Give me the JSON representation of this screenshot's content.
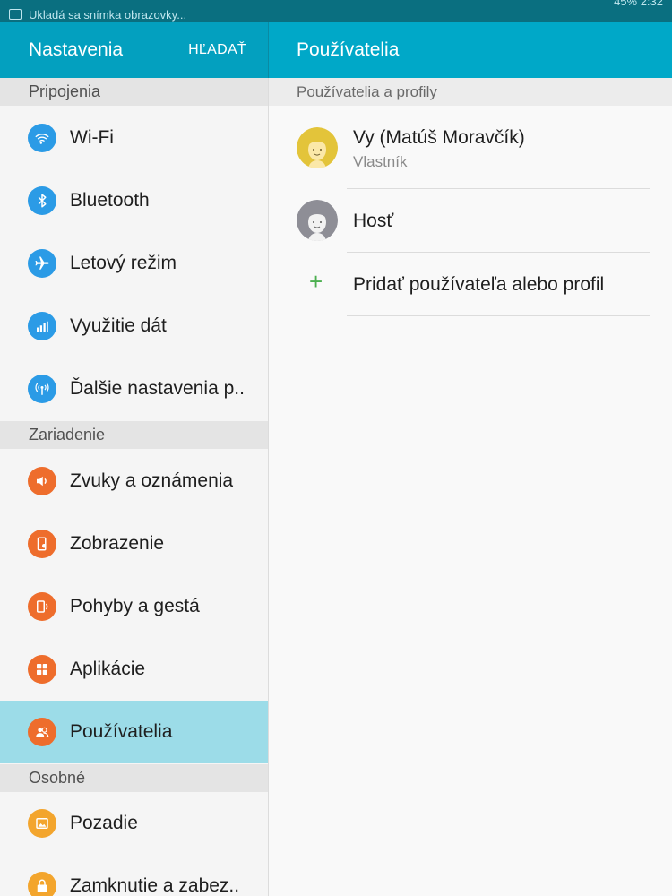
{
  "status_bar": {
    "notification_text": "Ukladá sa snímka obrazovky...",
    "right_text": "45% 2:32"
  },
  "header": {
    "title": "Nastavenia",
    "search_label": "HĽADAŤ",
    "detail_title": "Používatelia"
  },
  "sidebar": {
    "sections": [
      {
        "label": "Pripojenia"
      },
      {
        "label": "Zariadenie"
      },
      {
        "label": "Osobné"
      }
    ],
    "items": [
      {
        "label": "Wi-Fi",
        "icon": "wifi-icon",
        "color": "#2b9be6"
      },
      {
        "label": "Bluetooth",
        "icon": "bluetooth-icon",
        "color": "#2b9be6"
      },
      {
        "label": "Letový režim",
        "icon": "airplane-icon",
        "color": "#2b9be6"
      },
      {
        "label": "Využitie dát",
        "icon": "data-usage-icon",
        "color": "#2b9be6"
      },
      {
        "label": "Ďalšie nastavenia p..",
        "icon": "more-connections-icon",
        "color": "#2b9be6"
      },
      {
        "label": "Zvuky a oznámenia",
        "icon": "sound-icon",
        "color": "#ee6d2c"
      },
      {
        "label": "Zobrazenie",
        "icon": "display-icon",
        "color": "#ee6d2c"
      },
      {
        "label": "Pohyby a gestá",
        "icon": "motion-icon",
        "color": "#ee6d2c"
      },
      {
        "label": "Aplikácie",
        "icon": "apps-icon",
        "color": "#ee6d2c"
      },
      {
        "label": "Používatelia",
        "icon": "users-icon",
        "color": "#ee6d2c",
        "selected": true
      },
      {
        "label": "Pozadie",
        "icon": "wallpaper-icon",
        "color": "#f3a52d"
      },
      {
        "label": "Zamknutie a zabez..",
        "icon": "lock-icon",
        "color": "#f3a52d"
      }
    ]
  },
  "detail": {
    "section_label": "Používatelia a profily",
    "owner": {
      "name": "Vy (Matúš Moravčík)",
      "role": "Vlastník"
    },
    "guest": {
      "name": "Hosť"
    },
    "add_label": "Pridať používateľa alebo profil"
  }
}
